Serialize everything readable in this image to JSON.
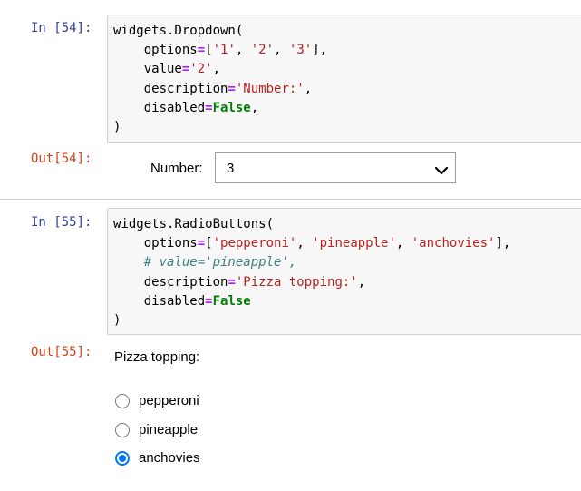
{
  "cells": [
    {
      "in_prompt": "In [54]:",
      "out_prompt": "Out[54]:",
      "code": {
        "l1_a": "widgets.Dropdown(",
        "l2_a": "    options",
        "l2_op": "=",
        "l2_b": "[",
        "l2_s1": "'1'",
        "l2_c1": ", ",
        "l2_s2": "'2'",
        "l2_c2": ", ",
        "l2_s3": "'3'",
        "l2_end": "],",
        "l3_a": "    value",
        "l3_op": "=",
        "l3_s": "'2'",
        "l3_end": ",",
        "l4_a": "    description",
        "l4_op": "=",
        "l4_s": "'Number:'",
        "l4_end": ",",
        "l5_a": "    disabled",
        "l5_op": "=",
        "l5_kw": "False",
        "l5_end": ",",
        "l6": ")"
      },
      "widget": {
        "label": "Number:",
        "selected_value": "3",
        "options": [
          "1",
          "2",
          "3"
        ]
      }
    },
    {
      "in_prompt": "In [55]:",
      "out_prompt": "Out[55]:",
      "code": {
        "l1_a": "widgets.RadioButtons(",
        "l2_a": "    options",
        "l2_op": "=",
        "l2_b": "[",
        "l2_s1": "'pepperoni'",
        "l2_c1": ", ",
        "l2_s2": "'pineapple'",
        "l2_c2": ", ",
        "l2_s3": "'anchovies'",
        "l2_end": "],",
        "l3_cm": "    # value='pineapple',",
        "l4_a": "    description",
        "l4_op": "=",
        "l4_s": "'Pizza topping:'",
        "l4_end": ",",
        "l5_a": "    disabled",
        "l5_op": "=",
        "l5_kw": "False",
        "l6": ")"
      },
      "widget": {
        "label": "Pizza topping:",
        "options": [
          {
            "label": "pepperoni",
            "checked": false
          },
          {
            "label": "pineapple",
            "checked": false
          },
          {
            "label": "anchovies",
            "checked": true
          }
        ]
      }
    }
  ],
  "colors": {
    "in_prompt": "#303f9f",
    "out_prompt": "#d84315",
    "keyword": "#008000",
    "operator": "#aa22ff",
    "string": "#ba2121",
    "comment": "#408080",
    "radio_accent": "#0075ff"
  },
  "icons": {
    "dropdown": "chevron-down-icon"
  }
}
